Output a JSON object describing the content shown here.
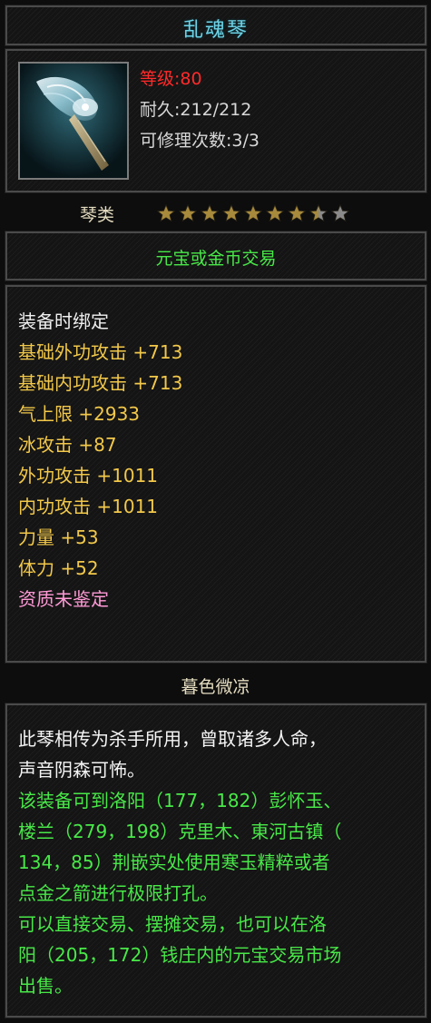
{
  "item": {
    "name": "乱魂琴",
    "level": "等级:80",
    "durability": "耐久:212/212",
    "repair_count": "可修理次数:3/3",
    "icon": "guqin-instrument-icon"
  },
  "category": {
    "label": "琴类",
    "stars_total": 9,
    "stars_filled": 7,
    "stars_half": 1,
    "star_filled_color": "#a88a3c",
    "star_empty_color": "#8a8a8a"
  },
  "trade_mode": "元宝或金币交易",
  "attributes": [
    {
      "text": "装备时绑定",
      "kind": "white"
    },
    {
      "text": "基础外功攻击 +713",
      "kind": "gold"
    },
    {
      "text": "基础内功攻击 +713",
      "kind": "gold"
    },
    {
      "text": "气上限 +2933",
      "kind": "gold"
    },
    {
      "text": "冰攻击 +87",
      "kind": "gold"
    },
    {
      "text": "外功攻击 +1011",
      "kind": "gold"
    },
    {
      "text": "内功攻击 +1011",
      "kind": "gold"
    },
    {
      "text": "力量 +53",
      "kind": "gold"
    },
    {
      "text": "体力 +52",
      "kind": "gold"
    },
    {
      "text": "资质未鉴定",
      "kind": "pink"
    }
  ],
  "set_name": "暮色微凉",
  "description": [
    {
      "text": "此琴相传为杀手所用，曾取诸多人命，",
      "kind": "white"
    },
    {
      "text": "声音阴森可怖。",
      "kind": "white"
    },
    {
      "text": "该装备可到洛阳（177，182）彭怀玉、",
      "kind": "green"
    },
    {
      "text": "楼兰（279，198）克里木、東河古镇（",
      "kind": "green"
    },
    {
      "text": "134，85）荆嵌实处使用寒玉精粹或者",
      "kind": "green"
    },
    {
      "text": "点金之箭进行极限打孔。",
      "kind": "green"
    },
    {
      "text": "可以直接交易、摆摊交易，也可以在洛",
      "kind": "green"
    },
    {
      "text": "阳（205，172）钱庄内的元宝交易市场",
      "kind": "green"
    },
    {
      "text": "出售。",
      "kind": "green"
    }
  ]
}
